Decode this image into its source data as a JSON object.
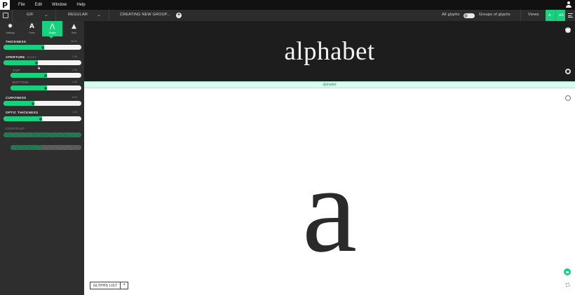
{
  "menubar": {
    "logo": "P",
    "items": [
      "File",
      "Edit",
      "Window",
      "Help"
    ]
  },
  "toolbar": {
    "font_family": "GIF",
    "font_variant": "REGULAR",
    "group_label": "CREATING NEW GROUP...",
    "all_glyphs_label": "All glyphs",
    "groups_label": "Groups of glyphs",
    "views_label": "Views",
    "view_buttons": [
      "A",
      "AA"
    ]
  },
  "sidebar": {
    "tabs": [
      {
        "label": "Settings",
        "icon": "gear-icon"
      },
      {
        "label": "Fonts",
        "icon": "font-icon"
      },
      {
        "label": "Shape",
        "icon": "shape-icon"
      },
      {
        "label": "Serif",
        "icon": "serif-icon"
      }
    ],
    "active_tab": 2,
    "params": [
      {
        "label": "THICKNESS",
        "value": "96.00",
        "fraction": 0.52
      },
      {
        "label": "APERTURE",
        "extra": "RESET",
        "value": "1.20",
        "fraction": 0.44
      },
      {
        "label": "TOP",
        "value": "1.20",
        "fraction": 0.5
      },
      {
        "label": "BOTTOM",
        "value": "1.20",
        "fraction": 0.5
      },
      {
        "label": "CURVINESS",
        "value": "0.54",
        "fraction": 0.4
      },
      {
        "label": "OPTIC THICKNESS",
        "value": "1.00",
        "fraction": 0.5
      },
      {
        "label": "CONTRAST",
        "value": "",
        "fraction": 0.3
      },
      {
        "label": "",
        "value": "",
        "fraction": 0.45
      }
    ]
  },
  "canvas": {
    "word": "alphabet",
    "strip_label": "alphabet",
    "glyph": "a"
  },
  "glyphs_list": {
    "label": "GLYPHS LIST",
    "add": "+"
  },
  "colors": {
    "accent": "#17d17e",
    "dark_panel": "#1d1d1d",
    "sidebar": "#2e2e2e"
  }
}
